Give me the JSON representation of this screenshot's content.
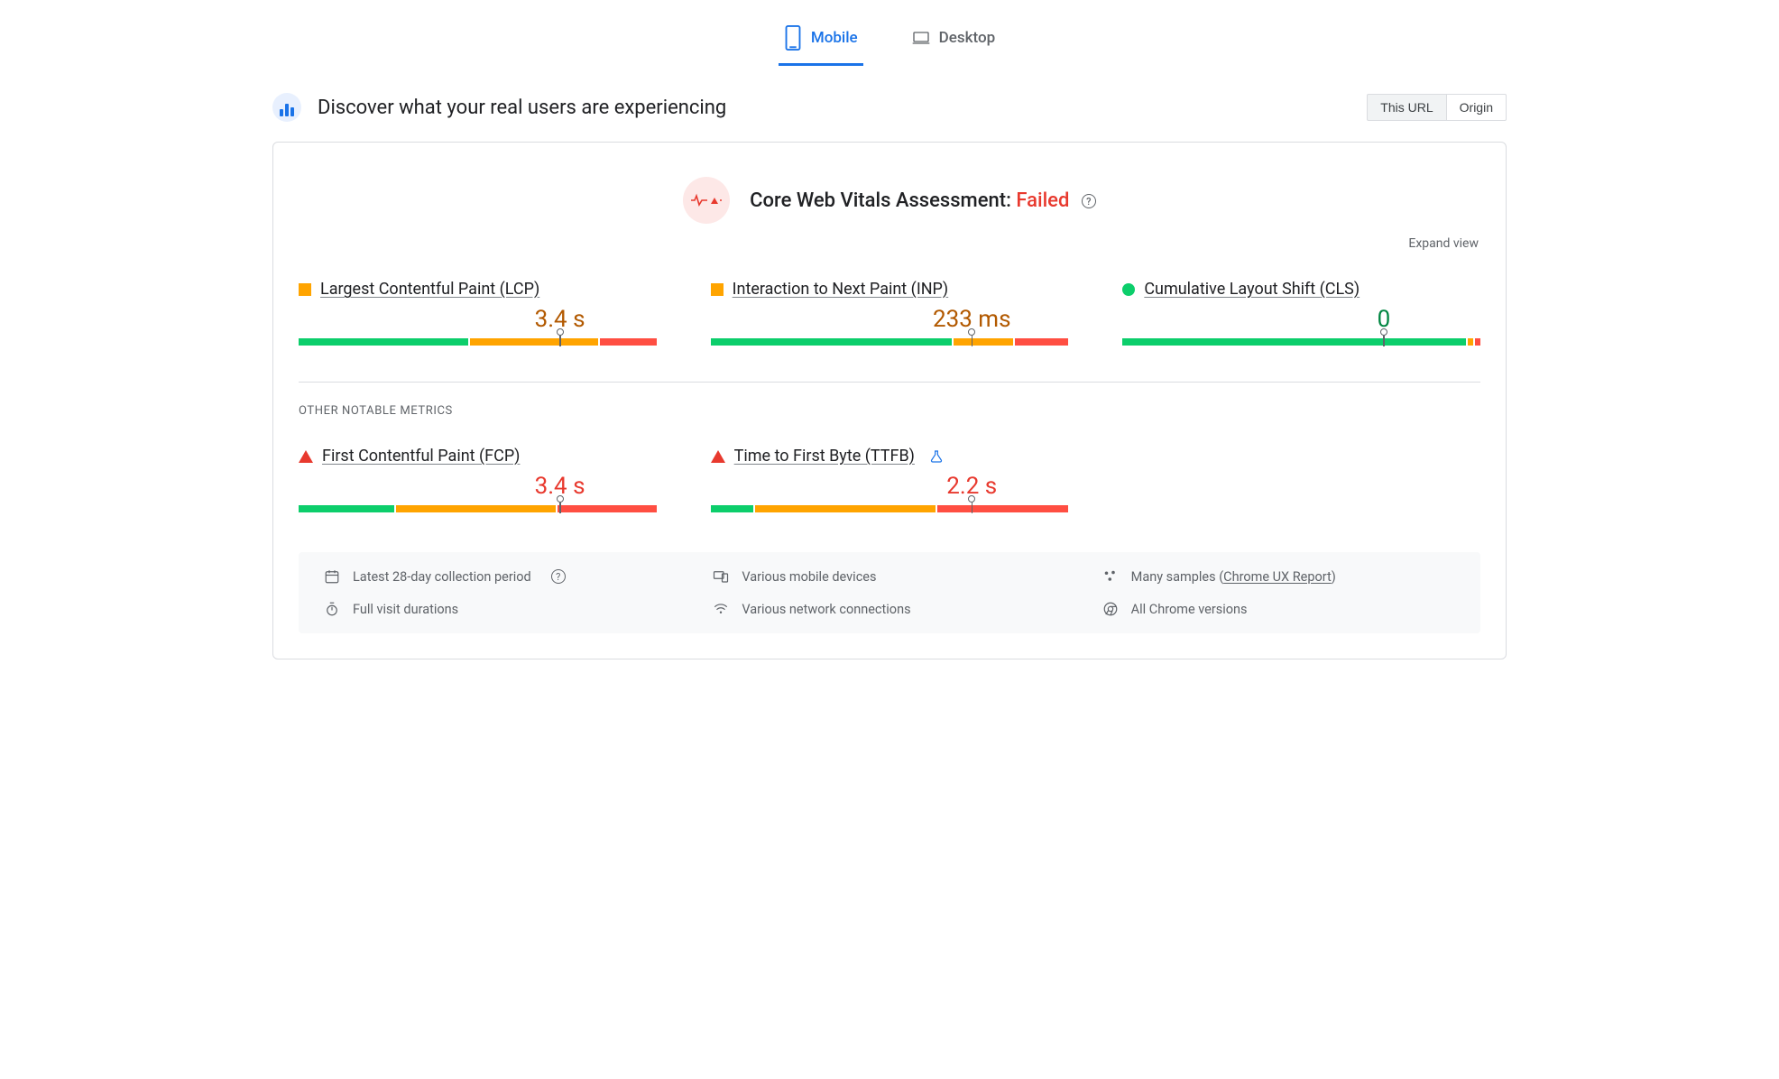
{
  "tabs": {
    "mobile": "Mobile",
    "desktop": "Desktop",
    "active": "mobile"
  },
  "header": {
    "title": "Discover what your real users are experiencing",
    "scope_url": "This URL",
    "scope_origin": "Origin"
  },
  "assessment": {
    "label": "Core Web Vitals Assessment: ",
    "status": "Failed"
  },
  "expand_view": "Expand view",
  "core_metrics": [
    {
      "name": "Largest Contentful Paint (LCP)",
      "status": "orange-square",
      "value": "3.4 s",
      "value_class": "val-orange",
      "dist": {
        "good": 48,
        "ni": 36,
        "poor": 16
      },
      "needle_pct": 73
    },
    {
      "name": "Interaction to Next Paint (INP)",
      "status": "orange-square",
      "value": "233 ms",
      "value_class": "val-orange",
      "dist": {
        "good": 68,
        "ni": 17,
        "poor": 15
      },
      "needle_pct": 73
    },
    {
      "name": "Cumulative Layout Shift (CLS)",
      "status": "green-circle",
      "value": "0",
      "value_class": "val-green",
      "dist": {
        "good": 97,
        "ni": 1.5,
        "poor": 1.5
      },
      "needle_pct": 73
    }
  ],
  "other_section_label": "OTHER NOTABLE METRICS",
  "other_metrics": [
    {
      "name": "First Contentful Paint (FCP)",
      "status": "red-triangle",
      "value": "3.4 s",
      "value_class": "val-red",
      "dist": {
        "good": 27,
        "ni": 45,
        "poor": 28
      },
      "needle_pct": 73,
      "flask": false
    },
    {
      "name": "Time to First Byte (TTFB)",
      "status": "red-triangle",
      "value": "2.2 s",
      "value_class": "val-red",
      "dist": {
        "good": 12,
        "ni": 51,
        "poor": 37
      },
      "needle_pct": 73,
      "flask": true
    }
  ],
  "notes": {
    "period": "Latest 28-day collection period",
    "devices": "Various mobile devices",
    "samples_prefix": "Many samples (",
    "samples_link": "Chrome UX Report",
    "samples_suffix": ")",
    "durations": "Full visit durations",
    "network": "Various network connections",
    "versions": "All Chrome versions"
  }
}
